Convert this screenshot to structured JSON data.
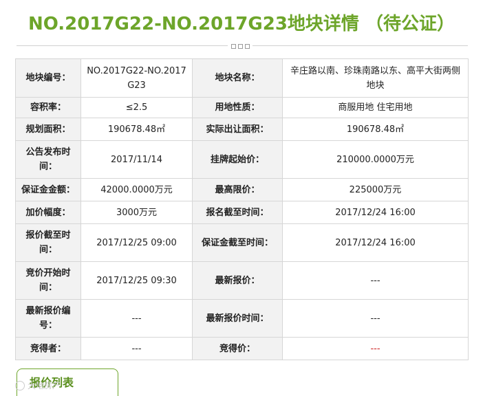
{
  "title": "NO.2017G22-NO.2017G23地块详情 （待公证）",
  "rows": [
    {
      "l1": "地块编号：",
      "v1": "NO.2017G22-NO.2017G23",
      "l2": "地块名称：",
      "v2": "辛庄路以南、珍珠南路以东、高平大街两侧地块"
    },
    {
      "l1": "容积率：",
      "v1": "≤2.5",
      "l2": "用地性质：",
      "v2": "商服用地 住宅用地"
    },
    {
      "l1": "规划面积：",
      "v1": "190678.48㎡",
      "l2": "实际出让面积：",
      "v2": "190678.48㎡"
    },
    {
      "l1": "公告发布时间：",
      "v1": "2017/11/14",
      "l2": "挂牌起始价：",
      "v2": "210000.0000万元"
    },
    {
      "l1": "保证金金额：",
      "v1": "42000.0000万元",
      "l2": "最高限价：",
      "v2": "225000万元"
    },
    {
      "l1": "加价幅度：",
      "v1": "3000万元",
      "l2": "报名截至时间：",
      "v2": "2017/12/24 16:00"
    },
    {
      "l1": "报价截至时间：",
      "v1": "2017/12/25 09:00",
      "l2": "保证金截至时间：",
      "v2": "2017/12/24 16:00"
    },
    {
      "l1": "竞价开始时间：",
      "v1": "2017/12/25 09:30",
      "l2": "最新报价：",
      "v2": "---"
    },
    {
      "l1": "最新报价编号：",
      "v1": "---",
      "l2": "最新报价时间：",
      "v2": "---"
    },
    {
      "l1": "竞得者：",
      "v1": "---",
      "l2": "竞得价：",
      "v2": "---"
    }
  ],
  "tab_label": "报价列表",
  "watermark": "大地房产",
  "colors": {
    "title": "#6da52a",
    "label_bg": "#f2f2f2",
    "border": "#d6d6d6",
    "price_red": "#cc2222"
  }
}
